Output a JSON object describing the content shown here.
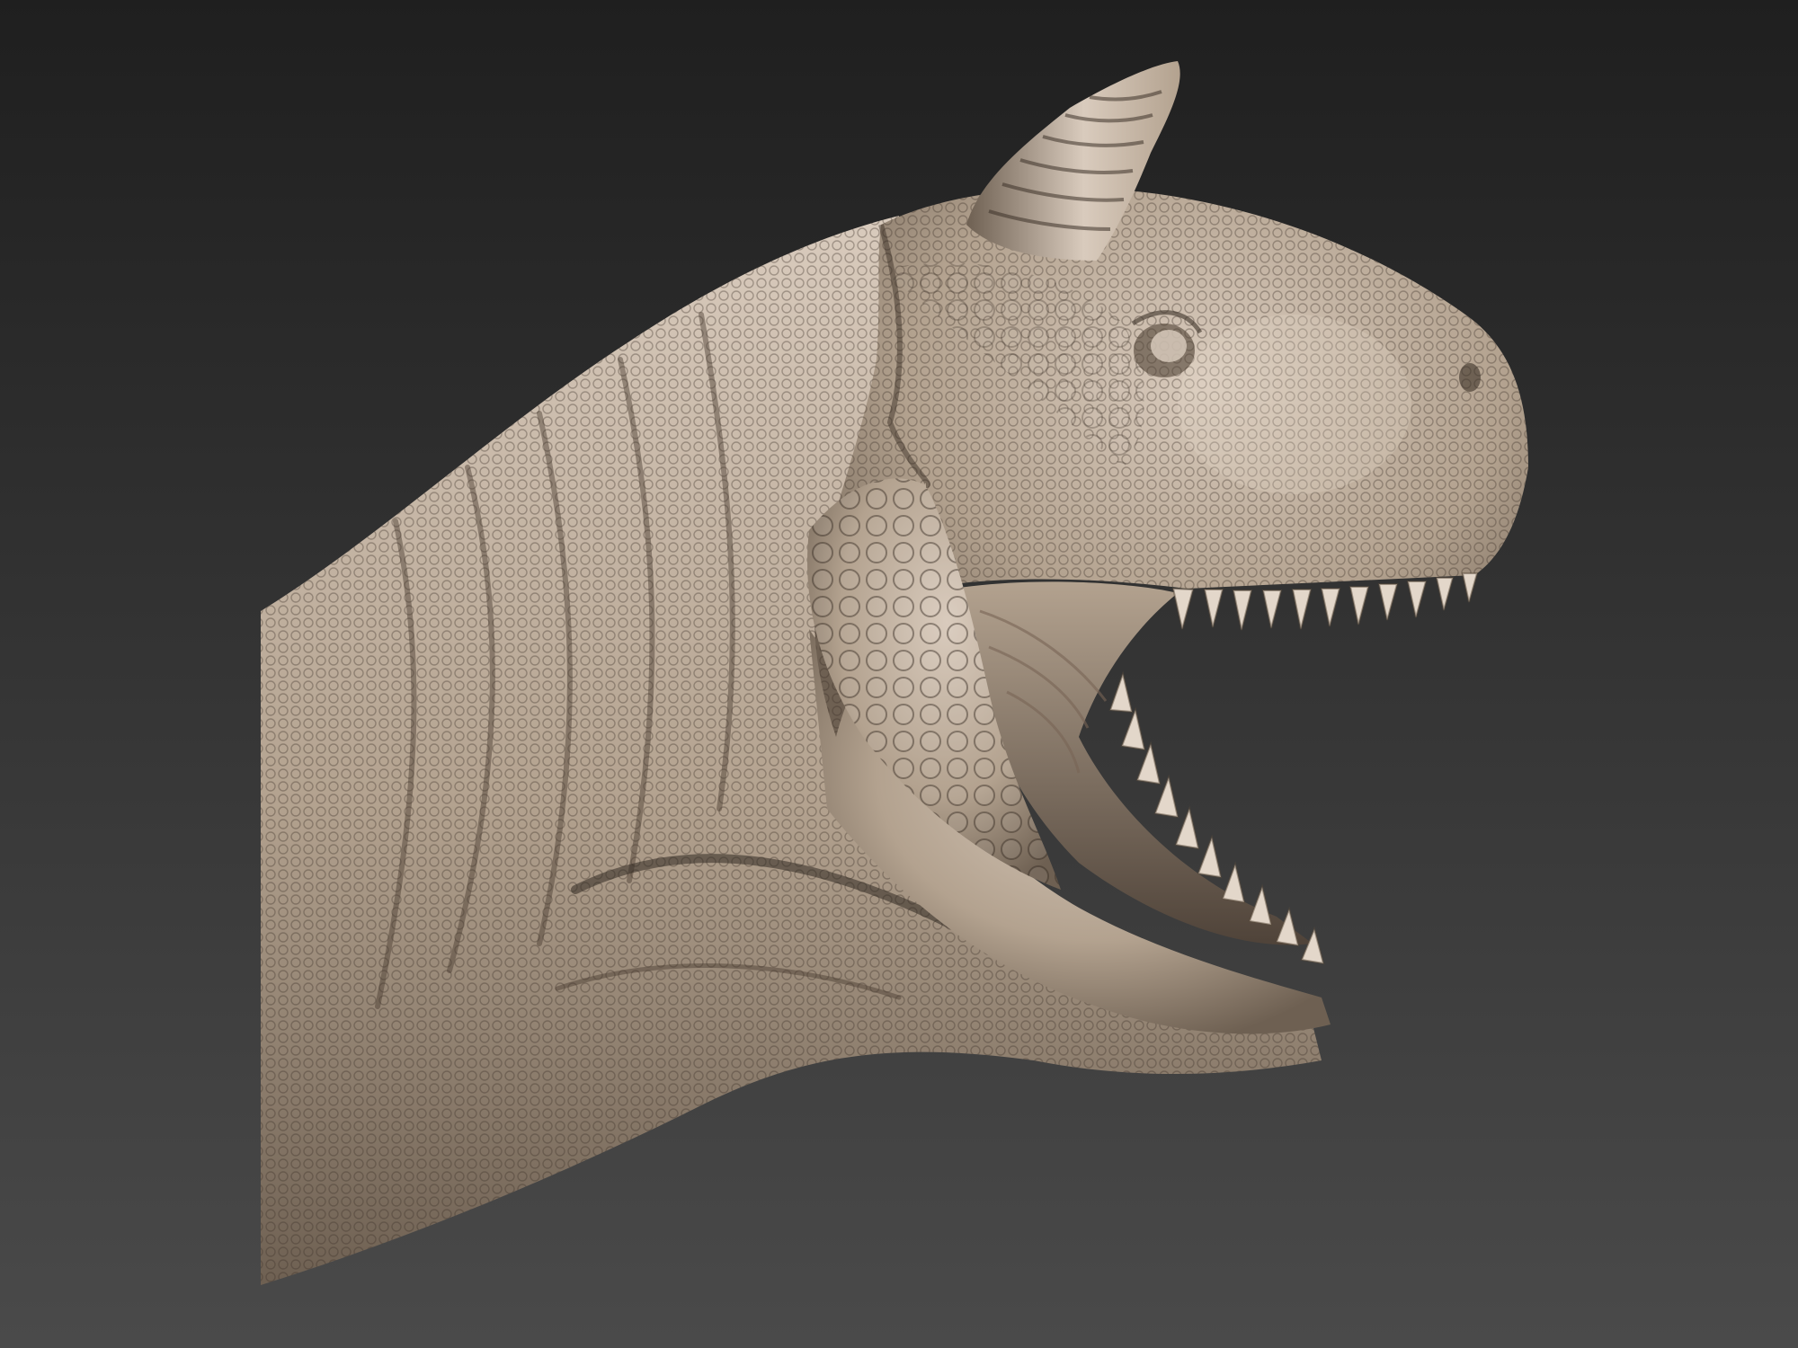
{
  "scene": {
    "subject": "sculpt-render",
    "colors": {
      "background_top": "#1f1f1f",
      "background_bottom": "#4a4a4a",
      "clay_highlight": "#d9cbbd",
      "clay_mid": "#b3a28f",
      "clay_shadow": "#6e6052",
      "clay_deep": "#3b332b",
      "mouth_shadow": "#4f4339"
    },
    "icons": [
      "horn",
      "eye",
      "teeth",
      "scales"
    ]
  }
}
